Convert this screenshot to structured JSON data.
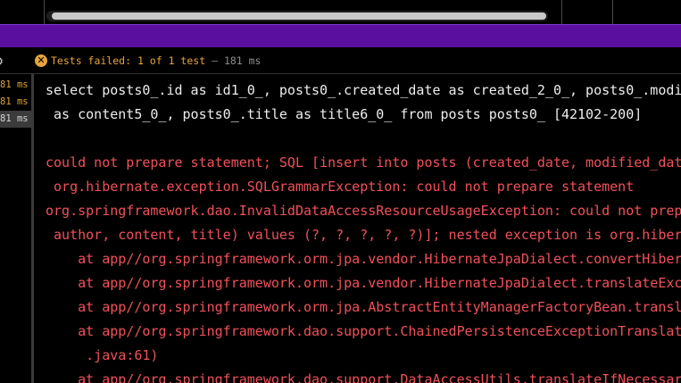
{
  "top_bar": {},
  "status": {
    "icon": "fail-circle-x-icon",
    "label": "Tests failed:",
    "count": "1 of 1 test",
    "separator": "–",
    "duration": "181 ms"
  },
  "test_tree": {
    "rows": [
      {
        "duration": "81 ms"
      },
      {
        "duration": "81 ms"
      },
      {
        "duration": "81 ms"
      }
    ]
  },
  "console": {
    "lines": [
      {
        "text": "select posts0_.id as id1_0_, posts0_.created_date as created_2_0_, posts0_.modi",
        "type": "stdout"
      },
      {
        "text": " as content5_0_, posts0_.title as title6_0_ from posts posts0_ [42102-200]",
        "type": "stdout"
      },
      {
        "text": "could not prepare statement; SQL [insert into posts (created_date, modified_dat",
        "type": "stderr"
      },
      {
        "text": " org.hibernate.exception.SQLGrammarException: could not prepare statement",
        "type": "stderr"
      },
      {
        "text": "org.springframework.dao.InvalidDataAccessResourceUsageException: could not prep",
        "type": "stderr"
      },
      {
        "text": " author, content, title) values (?, ?, ?, ?, ?)]; nested exception is org.hiber",
        "type": "stderr"
      },
      {
        "text": "    at app//org.springframework.orm.jpa.vendor.HibernateJpaDialect.convertHiber",
        "type": "stderr"
      },
      {
        "text": "    at app//org.springframework.orm.jpa.vendor.HibernateJpaDialect.translateExc",
        "type": "stderr"
      },
      {
        "text": "    at app//org.springframework.orm.jpa.AbstractEntityManagerFactoryBean.transl",
        "type": "stderr"
      },
      {
        "text": "    at app//org.springframework.dao.support.ChainedPersistenceExceptionTranslat",
        "type": "stderr"
      },
      {
        "text": "     .java:61)",
        "type": "stderr"
      },
      {
        "text": "    at app//org.springframework.dao.support.DataAccessUtils.translateIfNecessar",
        "type": "stderr"
      }
    ]
  },
  "colors": {
    "accent_purple": "#5b0f9e",
    "failed_orange": "#e8a33d",
    "stderr_red": "#f0515a",
    "stdout_white": "#ededed"
  }
}
